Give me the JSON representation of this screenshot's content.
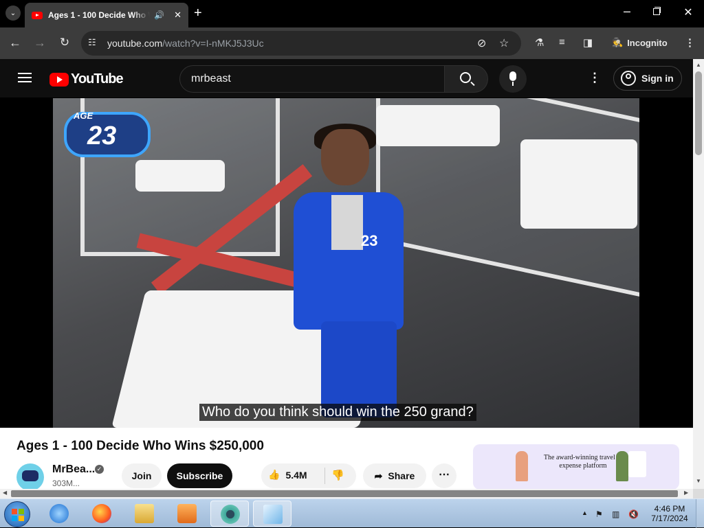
{
  "browser": {
    "tab_title": "Ages 1 - 100 Decide Who Wins $250,000",
    "url_host": "youtube.com",
    "url_path": "/watch?v=I-nMKJ5J3Uc",
    "profile_label": "Incognito"
  },
  "youtube": {
    "logo_text": "YouTube",
    "search_value": "mrbeast",
    "sign_in_label": "Sign in"
  },
  "video": {
    "age_label": "AGE",
    "age_number": "23",
    "jacket_number": "23",
    "caption": "Who do you think should win the 250 grand?"
  },
  "details": {
    "title": "Ages 1 - 100 Decide Who Wins $250,000",
    "channel_name": "MrBea...",
    "subscribers": "303M...",
    "join_label": "Join",
    "subscribe_label": "Subscribe",
    "likes": "5.4M",
    "share_label": "Share"
  },
  "ad": {
    "text": "The award-winning travel & expense platform"
  },
  "taskbar": {
    "time": "4:46 PM",
    "date": "7/17/2024"
  },
  "colors": {
    "youtube_red": "#ff0000",
    "jersey_blue": "#1f4fd4",
    "age_badge_border": "#3ea6ff"
  }
}
